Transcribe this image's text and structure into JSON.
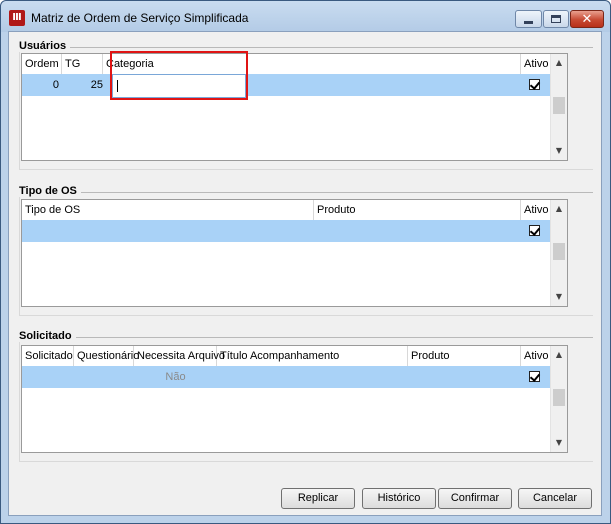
{
  "window": {
    "title": "Matriz de Ordem de Serviço Simplificada",
    "app_icon_glyph": "Ⅲ",
    "close_glyph": "✕"
  },
  "usuarios": {
    "title": "Usuários",
    "columns": [
      "Ordem",
      "TG",
      "Categoria",
      "Ativo"
    ],
    "rows": [
      {
        "ordem": "0",
        "tg": "25",
        "categoria": "",
        "ativo": true
      }
    ]
  },
  "tipo_os": {
    "title": "Tipo de OS",
    "columns": [
      "Tipo de OS",
      "Produto",
      "Ativo"
    ],
    "rows": [
      {
        "tipo": "",
        "produto": "",
        "ativo": true
      }
    ]
  },
  "solicitado": {
    "title": "Solicitado",
    "columns": [
      "Solicitado",
      "Questionário",
      "Necessita Arquivo",
      "Título Acompanhamento",
      "Produto",
      "Ativo"
    ],
    "rows": [
      {
        "solicitado": "",
        "questionario": "",
        "necessita_arquivo": "Não",
        "titulo": "",
        "produto": "",
        "ativo": true
      }
    ]
  },
  "scrollbar": {
    "up": "▲",
    "down": "▼"
  },
  "buttons": {
    "replicar": "Replicar",
    "historico": "Histórico",
    "confirmar": "Confirmar",
    "cancelar": "Cancelar"
  },
  "colors": {
    "selected_row": "#a9d2f7",
    "highlight_box": "#e01414"
  }
}
